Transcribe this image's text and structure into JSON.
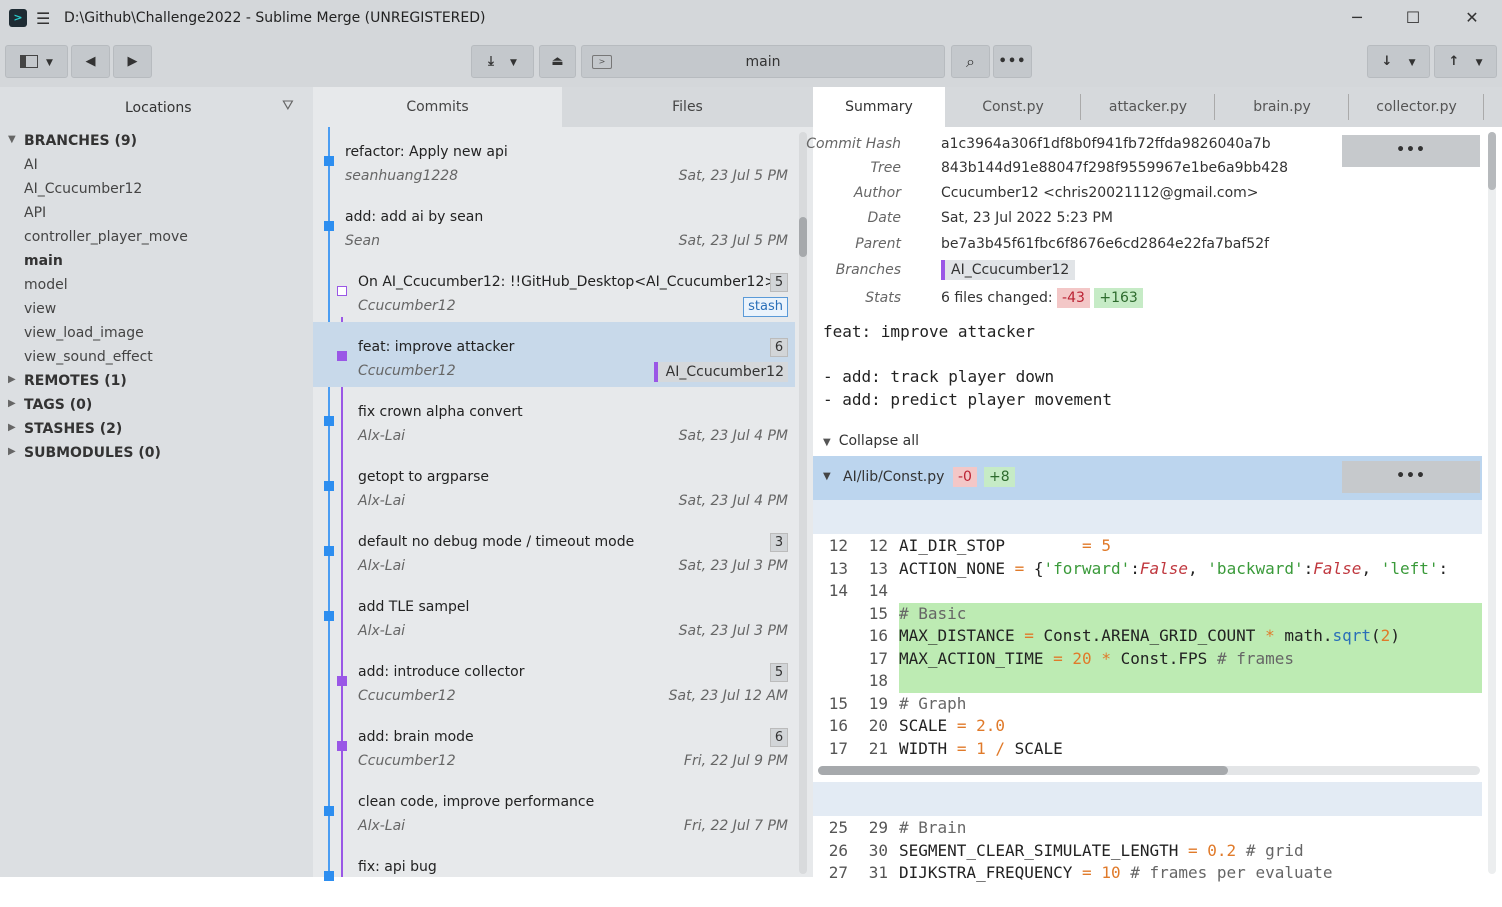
{
  "window": {
    "title": "D:\\Github\\Challenge2022 - Sublime Merge (UNREGISTERED)"
  },
  "toolbar": {
    "branch": "main",
    "more": "•••"
  },
  "sidebar": {
    "title": "Locations",
    "items": [
      {
        "label": "BRANCHES (9)",
        "bold": true,
        "arrow": "▼"
      },
      {
        "label": "AI"
      },
      {
        "label": "AI_Ccucumber12"
      },
      {
        "label": "API"
      },
      {
        "label": "controller_player_move"
      },
      {
        "label": "main",
        "bold": true
      },
      {
        "label": "model"
      },
      {
        "label": "view"
      },
      {
        "label": "view_load_image"
      },
      {
        "label": "view_sound_effect"
      },
      {
        "label": "REMOTES (1)",
        "bold": true,
        "arrow": "▶"
      },
      {
        "label": "TAGS (0)",
        "bold": true,
        "arrow": "▶"
      },
      {
        "label": "STASHES (2)",
        "bold": true,
        "arrow": "▶"
      },
      {
        "label": "SUBMODULES (0)",
        "bold": true,
        "arrow": "▶"
      }
    ]
  },
  "commits": {
    "tabs": [
      "Commits",
      "Files"
    ],
    "rows": [
      {
        "message": "refactor: Apply new api",
        "author": "seanhuang1228",
        "date": "Sat, 23 Jul 5 PM"
      },
      {
        "message": "add: add ai by sean",
        "author": "Sean",
        "date": "Sat, 23 Jul 5 PM"
      },
      {
        "message": "On AI_Ccucumber12: !!GitHub_Desktop<AI_Ccucumber12>",
        "author": "Ccucumber12",
        "count": "5",
        "badge": "stash"
      },
      {
        "message": "feat: improve attacker",
        "author": "Ccucumber12",
        "count": "6",
        "branch": "AI_Ccucumber12"
      },
      {
        "message": "fix crown alpha convert",
        "author": "Alx-Lai",
        "date": "Sat, 23 Jul 4 PM"
      },
      {
        "message": "getopt to argparse",
        "author": "Alx-Lai",
        "date": "Sat, 23 Jul 4 PM"
      },
      {
        "message": "default no debug mode / timeout mode",
        "author": "Alx-Lai",
        "date": "Sat, 23 Jul 3 PM",
        "count": "3"
      },
      {
        "message": "add TLE sampel",
        "author": "Alx-Lai",
        "date": "Sat, 23 Jul 3 PM"
      },
      {
        "message": "add: introduce collector",
        "author": "Ccucumber12",
        "date": "Sat, 23 Jul 12 AM",
        "count": "5"
      },
      {
        "message": "add: brain mode",
        "author": "Ccucumber12",
        "date": "Fri, 22 Jul 9 PM",
        "count": "6"
      },
      {
        "message": "clean code, improve performance",
        "author": "Alx-Lai",
        "date": "Fri, 22 Jul 7 PM"
      },
      {
        "message": "fix: api bug",
        "author": "",
        "date": ""
      }
    ]
  },
  "detail": {
    "tabs": [
      "Summary",
      "Const.py",
      "attacker.py",
      "brain.py",
      "collector.py"
    ],
    "meta": {
      "commit_hash_label": "Commit Hash",
      "commit_hash": "a1c3964a306f1df8b0f941fb72ffda9826040a7b",
      "tree_label": "Tree",
      "tree": "843b144d91e88047f298f9559967e1be6a9bb428",
      "author_label": "Author",
      "author": "Ccucumber12 <chris20021112@gmail.com>",
      "date_label": "Date",
      "date": "Sat, 23 Jul 2022 5:23 PM",
      "parent_label": "Parent",
      "parent": "be7a3b45f61fbc6f8676e6cd2864e22fa7baf52f",
      "branches_label": "Branches",
      "branch": "AI_Ccucumber12",
      "stats_label": "Stats",
      "stats_text": "6 files changed:",
      "deletions": "-43",
      "additions": "+163"
    },
    "message_title": "feat: improve attacker",
    "message_body": [
      "- add: track player down",
      "- add: predict player movement"
    ],
    "collapse_all": "Collapse all",
    "file": {
      "name": "AI/lib/Const.py",
      "deletions": "-0",
      "additions": "+8"
    },
    "hunk1": [
      {
        "o": "12",
        "n": "12",
        "code": "AI_DIR_STOP",
        "type": ""
      },
      {
        "o": "13",
        "n": "13",
        "code": "ACTION_NONE",
        "type": ""
      },
      {
        "o": "14",
        "n": "14",
        "code": "",
        "type": ""
      },
      {
        "o": "",
        "n": "15",
        "code": "# Basic",
        "type": "add"
      },
      {
        "o": "",
        "n": "16",
        "code": "MAX_DISTANCE",
        "type": "add"
      },
      {
        "o": "",
        "n": "17",
        "code": "MAX_ACTION_TIME",
        "type": "add"
      },
      {
        "o": "",
        "n": "18",
        "code": "",
        "type": "add"
      },
      {
        "o": "15",
        "n": "19",
        "code": "# Graph",
        "type": ""
      },
      {
        "o": "16",
        "n": "20",
        "code": "SCALE",
        "type": ""
      },
      {
        "o": "17",
        "n": "21",
        "code": "WIDTH",
        "type": ""
      }
    ],
    "hunk2": [
      {
        "o": "25",
        "n": "29",
        "code": "# Brain"
      },
      {
        "o": "26",
        "n": "30",
        "code": "SEGMENT_CLEAR_SIMULATE_LENGTH"
      },
      {
        "o": "27",
        "n": "31",
        "code": "DIJKSTRA_FREQUENCY"
      }
    ]
  }
}
